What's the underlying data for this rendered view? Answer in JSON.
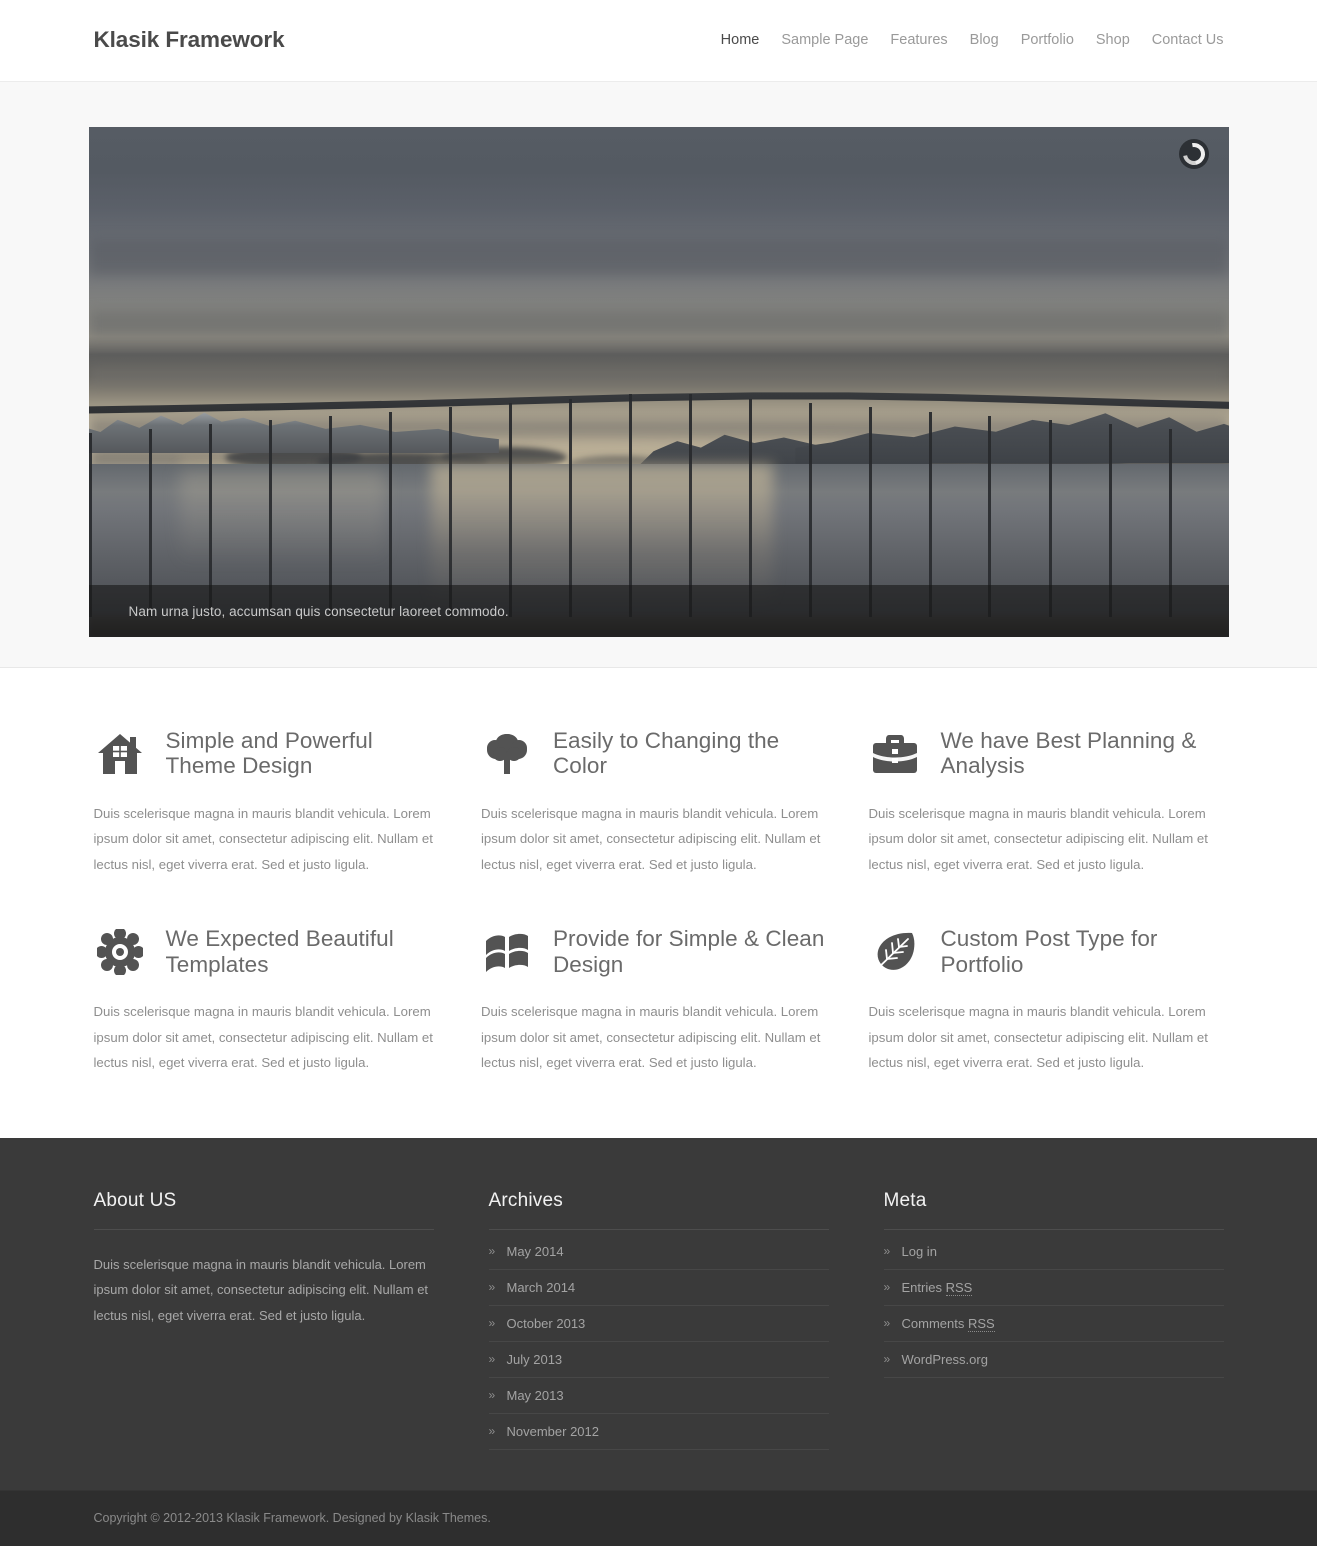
{
  "header": {
    "site_title": "Klasik Framework",
    "nav": [
      {
        "label": "Home",
        "active": true
      },
      {
        "label": "Sample Page",
        "active": false
      },
      {
        "label": "Features",
        "active": false
      },
      {
        "label": "Blog",
        "active": false
      },
      {
        "label": "Portfolio",
        "active": false
      },
      {
        "label": "Shop",
        "active": false
      },
      {
        "label": "Contact Us",
        "active": false
      }
    ]
  },
  "slider": {
    "caption": "Nam urna justo, accumsan quis consectetur laoreet commodo.",
    "spinner_icon": "loading-spinner-icon",
    "image_description": "Suspension bridge over a fjord at dusk with snow-capped mountains and golden sunset glow reflected on the water"
  },
  "features": [
    {
      "icon": "home-icon",
      "title": "Simple and Powerful Theme Design",
      "text": "Duis scelerisque magna in mauris blandit vehicula. Lorem ipsum dolor sit amet, consectetur adipiscing elit. Nullam et lectus nisl, eget viverra erat. Sed et justo ligula."
    },
    {
      "icon": "tree-icon",
      "title": "Easily to Changing the Color",
      "text": "Duis scelerisque magna in mauris blandit vehicula. Lorem ipsum dolor sit amet, consectetur adipiscing elit. Nullam et lectus nisl, eget viverra erat. Sed et justo ligula."
    },
    {
      "icon": "briefcase-icon",
      "title": "We have Best Planning & Analysis",
      "text": "Duis scelerisque magna in mauris blandit vehicula. Lorem ipsum dolor sit amet, consectetur adipiscing elit. Nullam et lectus nisl, eget viverra erat. Sed et justo ligula."
    },
    {
      "icon": "gear-icon",
      "title": "We Expected Beautiful Templates",
      "text": "Duis scelerisque magna in mauris blandit vehicula. Lorem ipsum dolor sit amet, consectetur adipiscing elit. Nullam et lectus nisl, eget viverra erat. Sed et justo ligula."
    },
    {
      "icon": "windows-flag-icon",
      "title": "Provide for Simple & Clean Design",
      "text": "Duis scelerisque magna in mauris blandit vehicula. Lorem ipsum dolor sit amet, consectetur adipiscing elit. Nullam et lectus nisl, eget viverra erat. Sed et justo ligula."
    },
    {
      "icon": "leaf-icon",
      "title": "Custom Post Type for Portfolio",
      "text": "Duis scelerisque magna in mauris blandit vehicula. Lorem ipsum dolor sit amet, consectetur adipiscing elit. Nullam et lectus nisl, eget viverra erat. Sed et justo ligula."
    }
  ],
  "footer": {
    "about": {
      "title": "About US",
      "text": "Duis scelerisque magna in mauris blandit vehicula. Lorem ipsum dolor sit amet, consectetur adipiscing elit. Nullam et lectus nisl, eget viverra erat. Sed et justo ligula."
    },
    "archives": {
      "title": "Archives",
      "bullet": "»",
      "items": [
        {
          "label": "May 2014"
        },
        {
          "label": "March 2014"
        },
        {
          "label": "October 2013"
        },
        {
          "label": "July 2013"
        },
        {
          "label": "May 2013"
        },
        {
          "label": "November 2012"
        }
      ]
    },
    "meta": {
      "title": "Meta",
      "bullet": "»",
      "items": [
        {
          "label": "Log in",
          "abbr": ""
        },
        {
          "label": "Entries ",
          "abbr": "RSS"
        },
        {
          "label": "Comments ",
          "abbr": "RSS"
        },
        {
          "label": "WordPress.org",
          "abbr": ""
        }
      ]
    },
    "copyright": "Copyright © 2012-2013 Klasik Framework. Designed by Klasik Themes."
  },
  "colors": {
    "header_bg": "#ffffff",
    "title_text": "#4a4a4a",
    "nav_inactive": "#9a9a9a",
    "slider_section_bg": "#f8f8f8",
    "feature_title": "#6a6a6a",
    "body_text": "#8e8e8e",
    "footer_bg": "#3a3a3a",
    "copyright_bg": "#2e2e2e",
    "icon_color": "#535353"
  }
}
